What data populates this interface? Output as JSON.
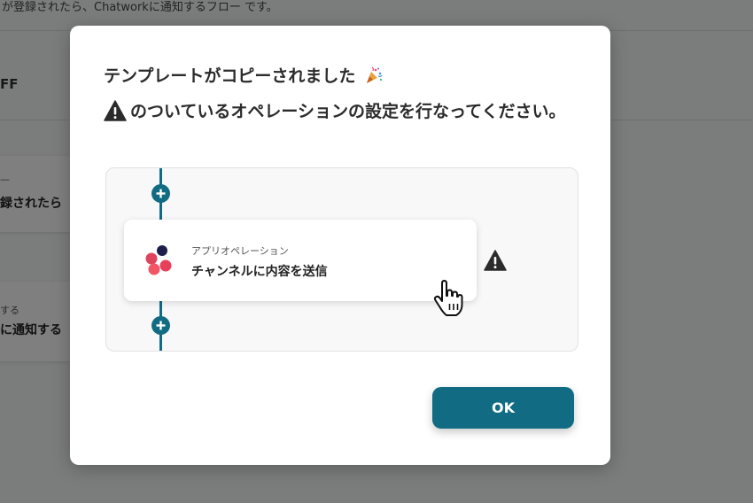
{
  "background": {
    "description": "が登録されたら、Chatworkに通知するフロー です。",
    "toggle_text": "FF",
    "card1": {
      "small_text": "—",
      "main_text": "録されたら"
    },
    "card2": {
      "small_text": "する",
      "main_text": "に通知する"
    }
  },
  "modal": {
    "title": "テンプレートがコピーされました",
    "title_icon": "party-popper-icon",
    "instruction": "のついているオペレーションの設定を行なってください。",
    "instruction_icon": "warning-icon",
    "flow": {
      "top_add_icon": "plus-icon",
      "bottom_add_icon": "plus-icon",
      "operation": {
        "label": "アプリオペレーション",
        "name": "チャンネルに内容を送信",
        "logo": "app-logo-icon"
      },
      "warning_icon": "warning-icon"
    },
    "ok_label": "OK"
  },
  "colors": {
    "accent": "#106b83",
    "overlay": "rgba(0,0,0,0.5)",
    "warning": "#2b2b2b"
  }
}
